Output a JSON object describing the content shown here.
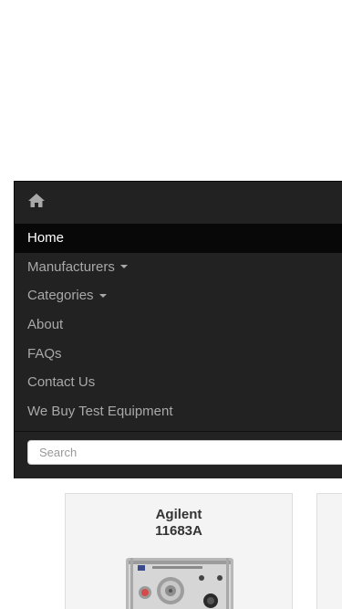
{
  "nav": {
    "brand_icon": "home-icon",
    "items": [
      {
        "label": "Home",
        "active": true,
        "dropdown": false
      },
      {
        "label": "Manufacturers",
        "active": false,
        "dropdown": true
      },
      {
        "label": "Categories",
        "active": false,
        "dropdown": true
      },
      {
        "label": "About",
        "active": false,
        "dropdown": false
      },
      {
        "label": "FAQs",
        "active": false,
        "dropdown": false
      },
      {
        "label": "Contact Us",
        "active": false,
        "dropdown": false
      },
      {
        "label": "We Buy Test Equipment",
        "active": false,
        "dropdown": false
      }
    ]
  },
  "search": {
    "placeholder": "Search"
  },
  "products": [
    {
      "brand": "Agilent",
      "model": "11683A"
    }
  ],
  "colors": {
    "navbar_bg": "#222222",
    "active_bg": "#080808",
    "nav_text": "#a9a9a9",
    "active_text": "#ffffff",
    "card_bg": "#f4f4f4"
  }
}
